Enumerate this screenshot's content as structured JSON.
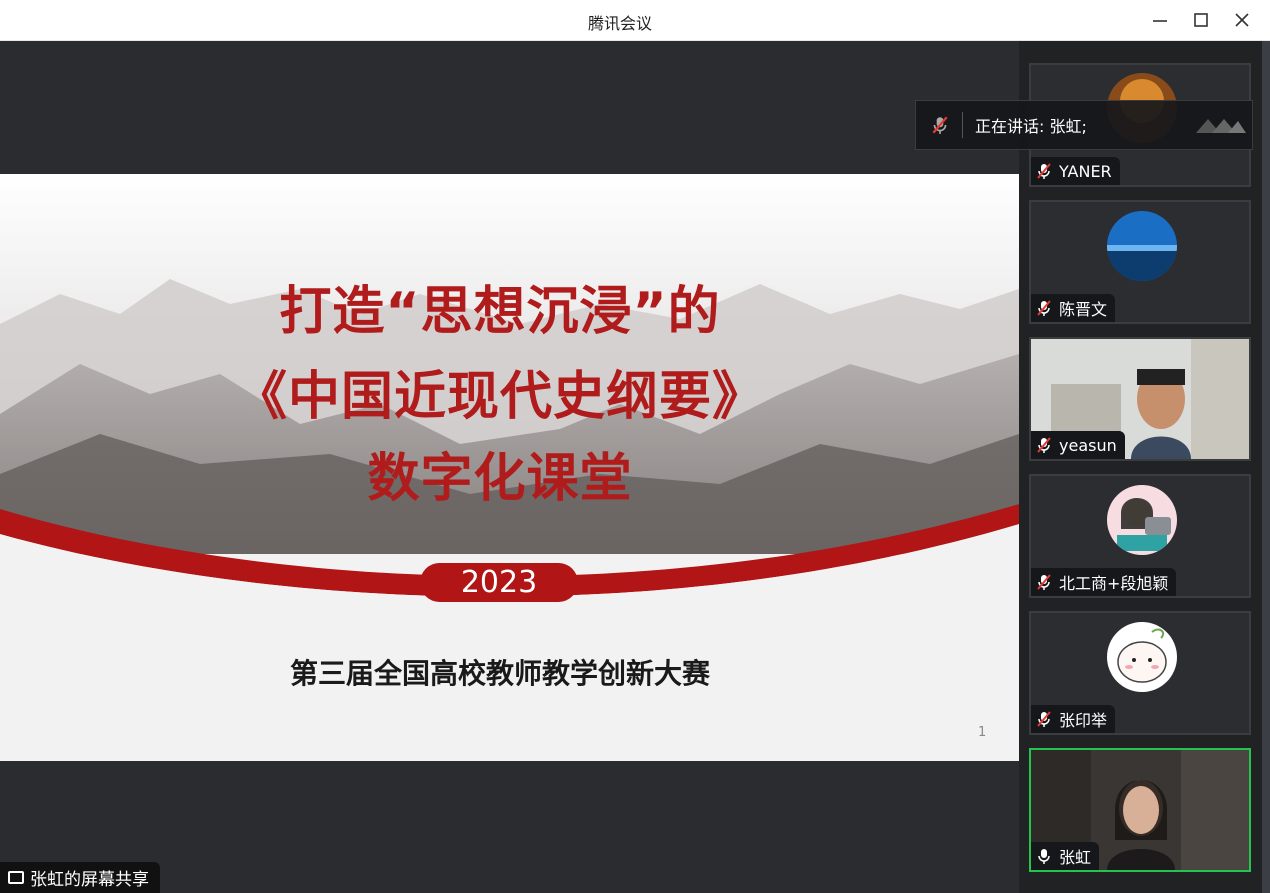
{
  "window": {
    "title": "腾讯会议",
    "minimize_icon": "minimize-icon",
    "maximize_icon": "maximize-icon",
    "close_icon": "close-icon"
  },
  "slide": {
    "title_line1": "打造“思想沉浸”的",
    "title_line2": "《中国近现代史纲要》",
    "title_line3": "数字化课堂",
    "year": "2023",
    "subtitle": "第三届全国高校教师教学创新大赛",
    "page_number": "1",
    "accent_color": "#b11516"
  },
  "speaking_banner": {
    "label": "正在讲话:  张虹;"
  },
  "screen_share": {
    "label": "张虹的屏幕共享"
  },
  "participants": [
    {
      "name": "YANER",
      "mic": "muted"
    },
    {
      "name": "陈晋文",
      "mic": "muted"
    },
    {
      "name": "yeasun",
      "mic": "muted"
    },
    {
      "name": "北工商+段旭颖",
      "mic": "muted"
    },
    {
      "name": "张印举",
      "mic": "muted"
    },
    {
      "name": "张虹",
      "mic": "on",
      "active": true
    }
  ],
  "colors": {
    "active_border": "#24c44e",
    "title_red": "#b01b1b"
  }
}
